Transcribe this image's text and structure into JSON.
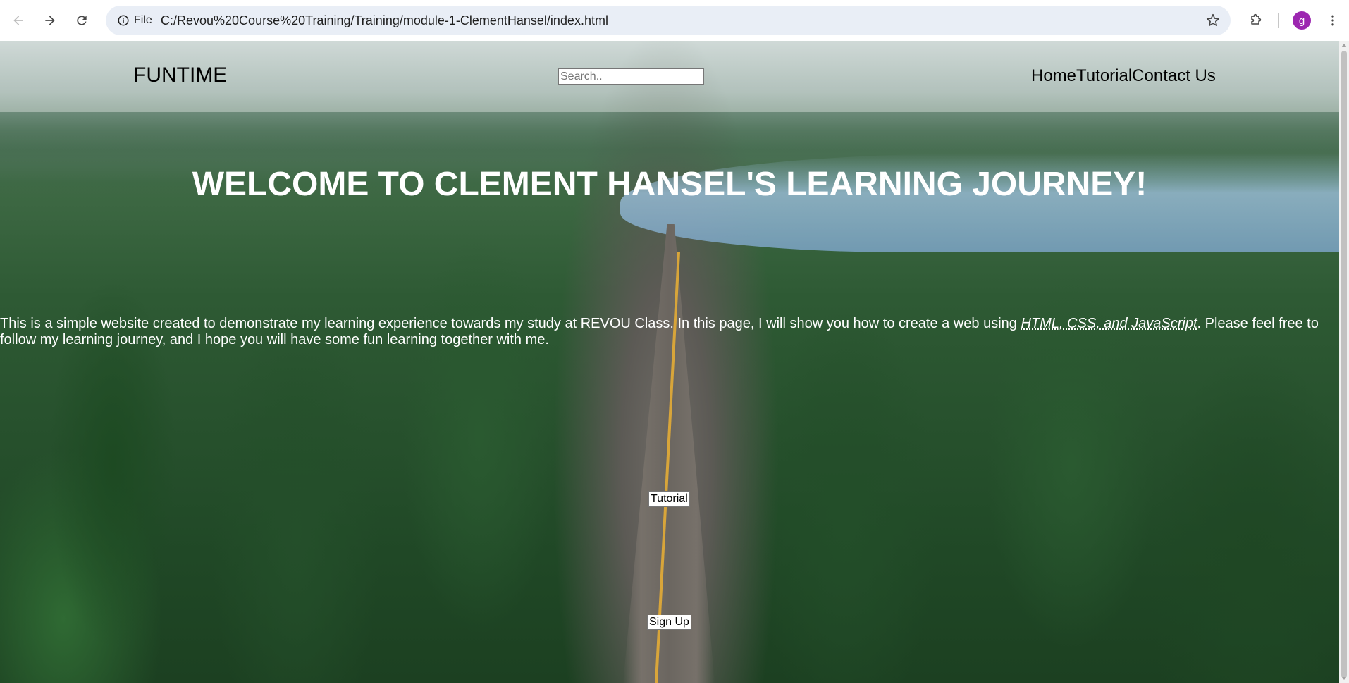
{
  "browser": {
    "url": "C:/Revou%20Course%20Training/Training/module-1-ClementHansel/index.html",
    "site_info_label": "File",
    "profile_initial": "g"
  },
  "site": {
    "brand": "FUNTIME",
    "search_placeholder": "Search..",
    "nav": [
      "Home",
      "Tutorial",
      "Contact Us"
    ],
    "hero_title": "WELCOME TO CLEMENT HANSEL'S LEARNING JOURNEY!",
    "intro_before": "This is a simple website created to demonstrate my learning experience towards my study at REVOU Class. In this page, I will show you how to create a web using ",
    "intro_abbr": "HTML, CSS, and JavaScript",
    "intro_after": ". Please feel free to follow my learning journey, and I hope you will have some fun learning together with me.",
    "tutorial_button": "Tutorial",
    "signup_button": "Sign Up"
  },
  "colors": {
    "omnibox_bg": "#e9eef6",
    "avatar_bg": "#9c27b0",
    "hero_text": "#ffffff"
  }
}
